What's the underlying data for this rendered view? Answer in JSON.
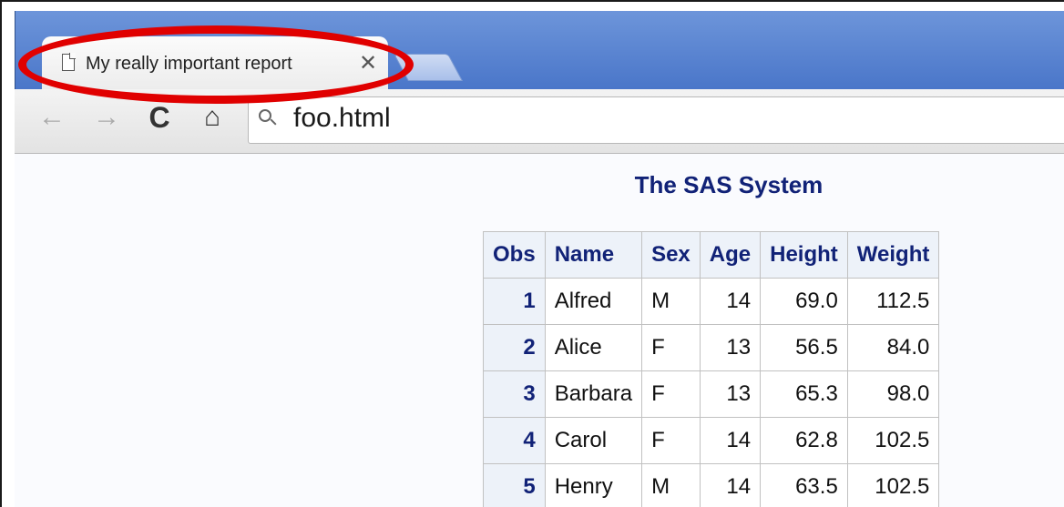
{
  "browser": {
    "tab_title": "My really important report",
    "tab_close_symbol": "✕",
    "address": "foo.html"
  },
  "icons": {
    "back": "←",
    "forward": "→",
    "reload": "C",
    "home": "⌂"
  },
  "report": {
    "title": "The SAS System",
    "columns": [
      "Obs",
      "Name",
      "Sex",
      "Age",
      "Height",
      "Weight"
    ],
    "rows": [
      [
        "1",
        "Alfred",
        "M",
        "14",
        "69.0",
        "112.5"
      ],
      [
        "2",
        "Alice",
        "F",
        "13",
        "56.5",
        "84.0"
      ],
      [
        "3",
        "Barbara",
        "F",
        "13",
        "65.3",
        "98.0"
      ],
      [
        "4",
        "Carol",
        "F",
        "14",
        "62.8",
        "102.5"
      ],
      [
        "5",
        "Henry",
        "M",
        "14",
        "63.5",
        "102.5"
      ]
    ]
  },
  "colors": {
    "annotation": "#e00000",
    "header_text": "#112277",
    "header_bg": "#edf2f9"
  }
}
